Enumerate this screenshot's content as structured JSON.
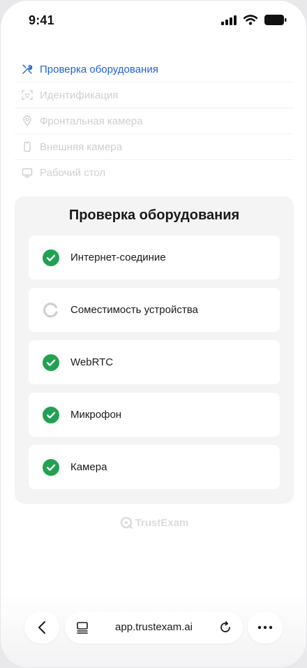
{
  "status_bar": {
    "time": "9:41"
  },
  "steps": [
    {
      "label": "Проверка оборудования",
      "icon": "tools-icon",
      "active": true
    },
    {
      "label": "Идентификация",
      "icon": "face-scan-icon",
      "active": false
    },
    {
      "label": "Фронтальная камера",
      "icon": "location-pin-icon",
      "active": false
    },
    {
      "label": "Внешняя камера",
      "icon": "phone-icon",
      "active": false
    },
    {
      "label": "Рабочий стол",
      "icon": "monitor-icon",
      "active": false
    }
  ],
  "check": {
    "title": "Проверка оборудования",
    "items": [
      {
        "label": "Интернет-соединие",
        "status": "done"
      },
      {
        "label": "Соместимость устройства",
        "status": "loading"
      },
      {
        "label": "WebRTC",
        "status": "done"
      },
      {
        "label": "Микрофон",
        "status": "done"
      },
      {
        "label": "Камера",
        "status": "done"
      }
    ]
  },
  "brand": {
    "name": "TrustExam"
  },
  "browser": {
    "url": "app.trustexam.ai"
  },
  "colors": {
    "accent": "#1f62d6",
    "success": "#21a153",
    "muted": "#cfcfd3"
  }
}
